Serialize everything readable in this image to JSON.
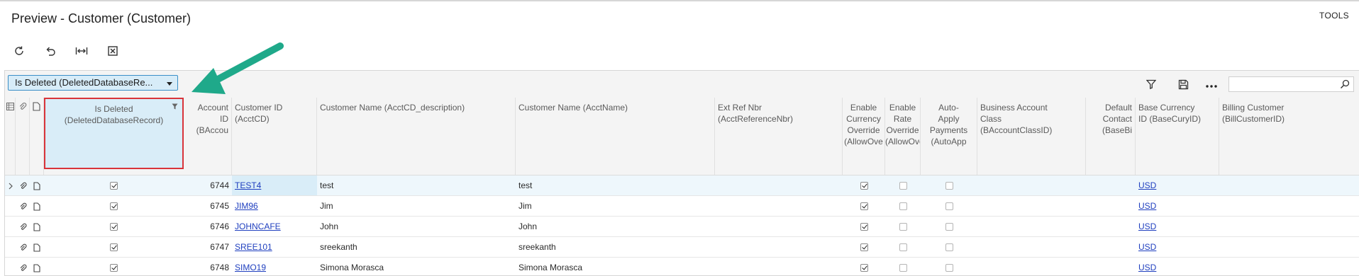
{
  "page": {
    "title": "Preview - Customer (Customer)",
    "tools_label": "TOOLS"
  },
  "toolbar": {
    "icons": [
      "refresh-icon",
      "undo-icon",
      "fit-to-screen-icon",
      "export-excel-icon"
    ]
  },
  "grid": {
    "group_by": {
      "selected": "Is Deleted (DeletedDatabaseRe..."
    },
    "search": {
      "placeholder": ""
    },
    "columns": [
      {
        "key": "deleted",
        "lines": [
          "Is Deleted",
          "(DeletedDatabaseRecord)"
        ]
      },
      {
        "key": "acct_id",
        "lines": [
          "Account",
          "ID",
          "(BAccou"
        ]
      },
      {
        "key": "cust_id",
        "lines": [
          "Customer ID",
          "(AcctCD)"
        ]
      },
      {
        "key": "cust_desc",
        "lines": [
          "Customer Name (AcctCD_description)"
        ]
      },
      {
        "key": "cust_name",
        "lines": [
          "Customer Name (AcctName)"
        ]
      },
      {
        "key": "extref",
        "lines": [
          "Ext Ref Nbr",
          "(AcctReferenceNbr)"
        ]
      },
      {
        "key": "curr_ovr",
        "lines": [
          "Enable",
          "Currency",
          "Override",
          "(AllowOve"
        ]
      },
      {
        "key": "rate_ovr",
        "lines": [
          "Enable",
          "Rate",
          "Override",
          "(AllowOve"
        ]
      },
      {
        "key": "autopay",
        "lines": [
          "Auto-",
          "Apply",
          "Payments",
          "(AutoApp"
        ]
      },
      {
        "key": "class",
        "lines": [
          "Business Account",
          "Class",
          "(BAccountClassID)"
        ]
      },
      {
        "key": "contact",
        "lines": [
          "Default",
          "Contact",
          "(BaseBi"
        ]
      },
      {
        "key": "basecury",
        "lines": [
          "Base Currency",
          "ID (BaseCuryID)"
        ]
      },
      {
        "key": "billcust",
        "lines": [
          "Billing Customer",
          "(BillCustomerID)"
        ]
      }
    ],
    "rows": [
      {
        "deleted": true,
        "acct_id": "6744",
        "cust_id": "TEST4",
        "cust_desc": "test",
        "cust_name": "test",
        "curr_ovr": true,
        "rate_ovr": false,
        "autopay": false,
        "basecury": "USD"
      },
      {
        "deleted": true,
        "acct_id": "6745",
        "cust_id": "JIM96",
        "cust_desc": "Jim",
        "cust_name": "Jim",
        "curr_ovr": true,
        "rate_ovr": false,
        "autopay": false,
        "basecury": "USD"
      },
      {
        "deleted": true,
        "acct_id": "6746",
        "cust_id": "JOHNCAFE",
        "cust_desc": "John",
        "cust_name": "John",
        "curr_ovr": true,
        "rate_ovr": false,
        "autopay": false,
        "basecury": "USD"
      },
      {
        "deleted": true,
        "acct_id": "6747",
        "cust_id": "SREE101",
        "cust_desc": "sreekanth",
        "cust_name": "sreekanth",
        "curr_ovr": true,
        "rate_ovr": false,
        "autopay": false,
        "basecury": "USD"
      },
      {
        "deleted": true,
        "acct_id": "6748",
        "cust_id": "SIMO19",
        "cust_desc": "Simona Morasca",
        "cust_name": "Simona Morasca",
        "curr_ovr": true,
        "rate_ovr": false,
        "autopay": false,
        "basecury": "USD"
      }
    ]
  },
  "colors": {
    "accent_arrow": "#1fa98a",
    "highlight_box": "#d9343a",
    "link": "#1f3fbf",
    "selected_fill": "#d9edf8"
  }
}
